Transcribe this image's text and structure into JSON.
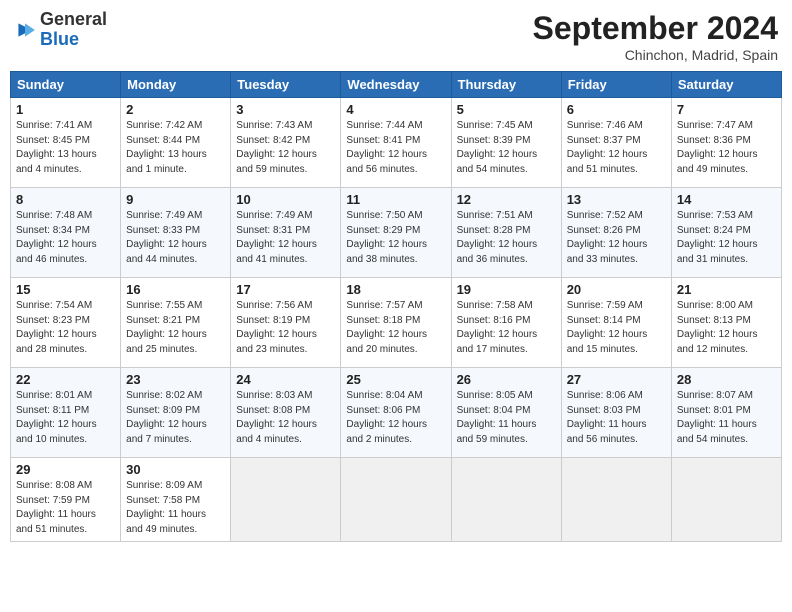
{
  "header": {
    "logo_general": "General",
    "logo_blue": "Blue",
    "month_title": "September 2024",
    "location": "Chinchon, Madrid, Spain"
  },
  "weekdays": [
    "Sunday",
    "Monday",
    "Tuesday",
    "Wednesday",
    "Thursday",
    "Friday",
    "Saturday"
  ],
  "weeks": [
    [
      {
        "day": "1",
        "info": "Sunrise: 7:41 AM\nSunset: 8:45 PM\nDaylight: 13 hours\nand 4 minutes."
      },
      {
        "day": "2",
        "info": "Sunrise: 7:42 AM\nSunset: 8:44 PM\nDaylight: 13 hours\nand 1 minute."
      },
      {
        "day": "3",
        "info": "Sunrise: 7:43 AM\nSunset: 8:42 PM\nDaylight: 12 hours\nand 59 minutes."
      },
      {
        "day": "4",
        "info": "Sunrise: 7:44 AM\nSunset: 8:41 PM\nDaylight: 12 hours\nand 56 minutes."
      },
      {
        "day": "5",
        "info": "Sunrise: 7:45 AM\nSunset: 8:39 PM\nDaylight: 12 hours\nand 54 minutes."
      },
      {
        "day": "6",
        "info": "Sunrise: 7:46 AM\nSunset: 8:37 PM\nDaylight: 12 hours\nand 51 minutes."
      },
      {
        "day": "7",
        "info": "Sunrise: 7:47 AM\nSunset: 8:36 PM\nDaylight: 12 hours\nand 49 minutes."
      }
    ],
    [
      {
        "day": "8",
        "info": "Sunrise: 7:48 AM\nSunset: 8:34 PM\nDaylight: 12 hours\nand 46 minutes."
      },
      {
        "day": "9",
        "info": "Sunrise: 7:49 AM\nSunset: 8:33 PM\nDaylight: 12 hours\nand 44 minutes."
      },
      {
        "day": "10",
        "info": "Sunrise: 7:49 AM\nSunset: 8:31 PM\nDaylight: 12 hours\nand 41 minutes."
      },
      {
        "day": "11",
        "info": "Sunrise: 7:50 AM\nSunset: 8:29 PM\nDaylight: 12 hours\nand 38 minutes."
      },
      {
        "day": "12",
        "info": "Sunrise: 7:51 AM\nSunset: 8:28 PM\nDaylight: 12 hours\nand 36 minutes."
      },
      {
        "day": "13",
        "info": "Sunrise: 7:52 AM\nSunset: 8:26 PM\nDaylight: 12 hours\nand 33 minutes."
      },
      {
        "day": "14",
        "info": "Sunrise: 7:53 AM\nSunset: 8:24 PM\nDaylight: 12 hours\nand 31 minutes."
      }
    ],
    [
      {
        "day": "15",
        "info": "Sunrise: 7:54 AM\nSunset: 8:23 PM\nDaylight: 12 hours\nand 28 minutes."
      },
      {
        "day": "16",
        "info": "Sunrise: 7:55 AM\nSunset: 8:21 PM\nDaylight: 12 hours\nand 25 minutes."
      },
      {
        "day": "17",
        "info": "Sunrise: 7:56 AM\nSunset: 8:19 PM\nDaylight: 12 hours\nand 23 minutes."
      },
      {
        "day": "18",
        "info": "Sunrise: 7:57 AM\nSunset: 8:18 PM\nDaylight: 12 hours\nand 20 minutes."
      },
      {
        "day": "19",
        "info": "Sunrise: 7:58 AM\nSunset: 8:16 PM\nDaylight: 12 hours\nand 17 minutes."
      },
      {
        "day": "20",
        "info": "Sunrise: 7:59 AM\nSunset: 8:14 PM\nDaylight: 12 hours\nand 15 minutes."
      },
      {
        "day": "21",
        "info": "Sunrise: 8:00 AM\nSunset: 8:13 PM\nDaylight: 12 hours\nand 12 minutes."
      }
    ],
    [
      {
        "day": "22",
        "info": "Sunrise: 8:01 AM\nSunset: 8:11 PM\nDaylight: 12 hours\nand 10 minutes."
      },
      {
        "day": "23",
        "info": "Sunrise: 8:02 AM\nSunset: 8:09 PM\nDaylight: 12 hours\nand 7 minutes."
      },
      {
        "day": "24",
        "info": "Sunrise: 8:03 AM\nSunset: 8:08 PM\nDaylight: 12 hours\nand 4 minutes."
      },
      {
        "day": "25",
        "info": "Sunrise: 8:04 AM\nSunset: 8:06 PM\nDaylight: 12 hours\nand 2 minutes."
      },
      {
        "day": "26",
        "info": "Sunrise: 8:05 AM\nSunset: 8:04 PM\nDaylight: 11 hours\nand 59 minutes."
      },
      {
        "day": "27",
        "info": "Sunrise: 8:06 AM\nSunset: 8:03 PM\nDaylight: 11 hours\nand 56 minutes."
      },
      {
        "day": "28",
        "info": "Sunrise: 8:07 AM\nSunset: 8:01 PM\nDaylight: 11 hours\nand 54 minutes."
      }
    ],
    [
      {
        "day": "29",
        "info": "Sunrise: 8:08 AM\nSunset: 7:59 PM\nDaylight: 11 hours\nand 51 minutes."
      },
      {
        "day": "30",
        "info": "Sunrise: 8:09 AM\nSunset: 7:58 PM\nDaylight: 11 hours\nand 49 minutes."
      },
      {
        "day": "",
        "info": ""
      },
      {
        "day": "",
        "info": ""
      },
      {
        "day": "",
        "info": ""
      },
      {
        "day": "",
        "info": ""
      },
      {
        "day": "",
        "info": ""
      }
    ]
  ]
}
